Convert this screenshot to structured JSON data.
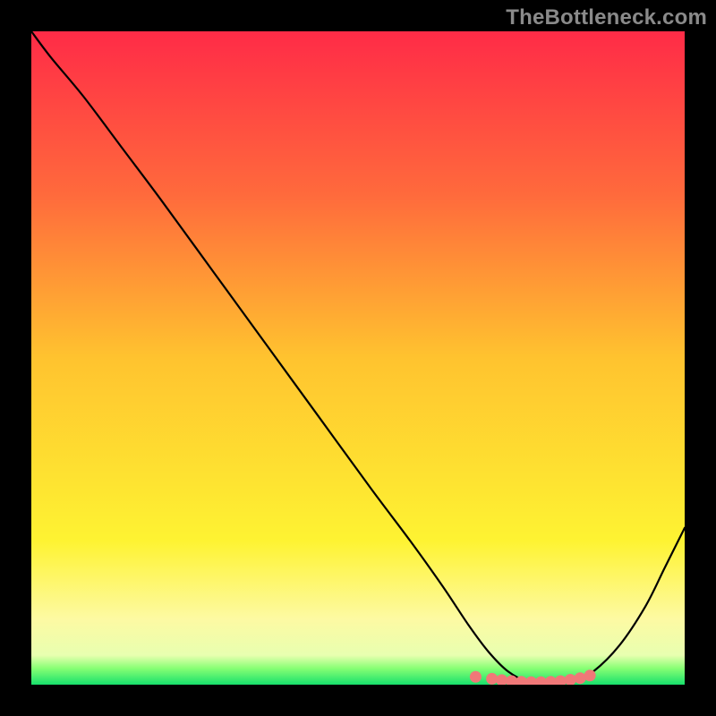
{
  "watermark": "TheBottleneck.com",
  "chart_data": {
    "type": "line",
    "title": "",
    "xlabel": "",
    "ylabel": "",
    "xlim": [
      0,
      100
    ],
    "ylim": [
      0,
      100
    ],
    "grid": false,
    "legend": false,
    "gradient_stops": [
      {
        "offset": 0.0,
        "color": "#ff2b47"
      },
      {
        "offset": 0.25,
        "color": "#ff6a3c"
      },
      {
        "offset": 0.5,
        "color": "#ffc32f"
      },
      {
        "offset": 0.78,
        "color": "#fef332"
      },
      {
        "offset": 0.9,
        "color": "#fdfaa3"
      },
      {
        "offset": 0.955,
        "color": "#e8ffb0"
      },
      {
        "offset": 0.975,
        "color": "#87ff74"
      },
      {
        "offset": 1.0,
        "color": "#17e06c"
      }
    ],
    "series": [
      {
        "name": "bottleneck-curve",
        "x": [
          0,
          3,
          8,
          14,
          20,
          28,
          36,
          44,
          52,
          58,
          63,
          67,
          70,
          73,
          76,
          80,
          83,
          86,
          90,
          94,
          97,
          100
        ],
        "y": [
          100,
          96,
          90,
          82,
          74,
          63,
          52,
          41,
          30,
          22,
          15,
          9,
          5,
          2,
          0.5,
          0.3,
          0.5,
          2,
          6,
          12,
          18,
          24
        ]
      },
      {
        "name": "marker-cluster",
        "type": "scatter",
        "color": "#f07878",
        "x": [
          68,
          70.5,
          72,
          73.5,
          75,
          76.5,
          78,
          79.5,
          81,
          82.5,
          84,
          85.5
        ],
        "y": [
          1.2,
          0.9,
          0.7,
          0.55,
          0.45,
          0.4,
          0.4,
          0.45,
          0.55,
          0.75,
          1.0,
          1.4
        ]
      }
    ]
  }
}
